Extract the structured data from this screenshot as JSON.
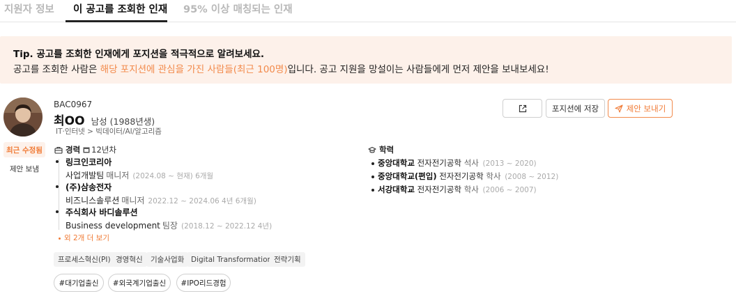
{
  "tabs": [
    {
      "label": "지원자 정보"
    },
    {
      "label": "이 공고를 조회한 인재"
    },
    {
      "label": "95% 이상 매칭되는 인재"
    }
  ],
  "tip": {
    "title": "Tip. 공고를 조회한 인재에게 포지션을 적극적으로 알려보세요.",
    "desc_prefix": "공고를 조회한 사람은 ",
    "desc_highlight": "해당 포지션에 관심을 가진 사람들(최근 100명)",
    "desc_suffix": "입니다. 공고 지원을 망설이는 사람들에게 먼저 제안을 보내보세요!"
  },
  "candidate": {
    "code": "BAC0967",
    "name": "최OO",
    "gender_birth": "남성 (1988년생)",
    "category": "IT·인터넷 > 빅데이터/AI/알고리즘",
    "badge_recent": "최근 수정됨",
    "proposal_sent": "제안 보냄"
  },
  "actions": {
    "save_label": "포지션에 저장",
    "offer_label": "제안 보내기"
  },
  "experience": {
    "heading": "경력",
    "years": "12년차",
    "items": [
      {
        "company": "링크인코리아",
        "role": "사업개발팀",
        "level": "매니저",
        "period": "(2024.08 ~ 현재)  6개월"
      },
      {
        "company": "(주)삼송전자",
        "role": "비즈니스솔루션",
        "level": "매니저",
        "period": "2022.12 ~ 2024.06  4년 6개월)"
      },
      {
        "company": "주식회사 바디솔루션",
        "role": "Business development",
        "level": "팀장",
        "period": "(2018.12 ~ 2022.12  4년)"
      }
    ],
    "more_label": "외 2개 더 보기"
  },
  "education": {
    "heading": "학력",
    "items": [
      {
        "school": "중앙대학교",
        "major": "전자전기공학",
        "degree": "석사",
        "period": "(2013 ~ 2020)"
      },
      {
        "school": "중앙대학교(편입)",
        "major": "전자전기공학",
        "degree": "학사",
        "period": "(2008 ~ 2012)"
      },
      {
        "school": "서강대학교",
        "major": "전자전기공학",
        "degree": "학사",
        "period": "(2006 ~ 2007)"
      }
    ]
  },
  "skills": [
    "프로세스혁신(PI)",
    "경영혁신",
    "기술사업화",
    "Digital Transformation",
    "전략기획"
  ],
  "hashtags": [
    "#대기업출신",
    "#외국계기업출신",
    "#IPO리드경험"
  ],
  "colors": {
    "accent": "#f28a4b",
    "tip_bg": "#fdf1ea"
  }
}
